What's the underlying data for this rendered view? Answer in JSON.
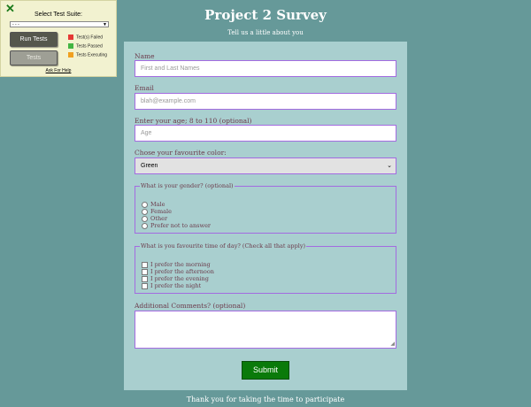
{
  "test_panel": {
    "close_glyph": "✕",
    "title": "Select Test Suite:",
    "suite_value": "- - -",
    "run_label": "Run Tests",
    "tests_label": "Tests",
    "legend": [
      {
        "label": "Test(s) Failed",
        "color": "#e53935"
      },
      {
        "label": "Tests Passed",
        "color": "#43b543"
      },
      {
        "label": "Tests Executing",
        "color": "#f0a020"
      }
    ],
    "help_link": "Ask For Help"
  },
  "header": {
    "title": "Project 2 Survey",
    "subtitle": "Tell us a little about you"
  },
  "form": {
    "name_label": "Name",
    "name_placeholder": "First and Last Names",
    "email_label": "Email",
    "email_placeholder": "blah@example.com",
    "age_label": "Enter your age; 8 to 110 (optional)",
    "age_placeholder": "Age",
    "color_label": "Chose your favourite color:",
    "color_value": "Green",
    "gender_legend": "What is your gender? (optional)",
    "gender_options": [
      "Male",
      "Female",
      "Other",
      "Prefer not to answer"
    ],
    "time_legend": "What is you favourite time of day? (Check all that apply)",
    "time_options": [
      "I prefer the morning",
      "I prefer the afternoon",
      "I prefer the evening",
      "I prefer the night"
    ],
    "comments_label": "Additional Comments? (optional)",
    "submit_label": "Submit"
  },
  "footer": "Thank you for taking the time to participate",
  "colors": {
    "background": "#669999",
    "card": "#a9cfcf",
    "accent_border": "#a36be0",
    "submit": "#0a7a0a"
  }
}
